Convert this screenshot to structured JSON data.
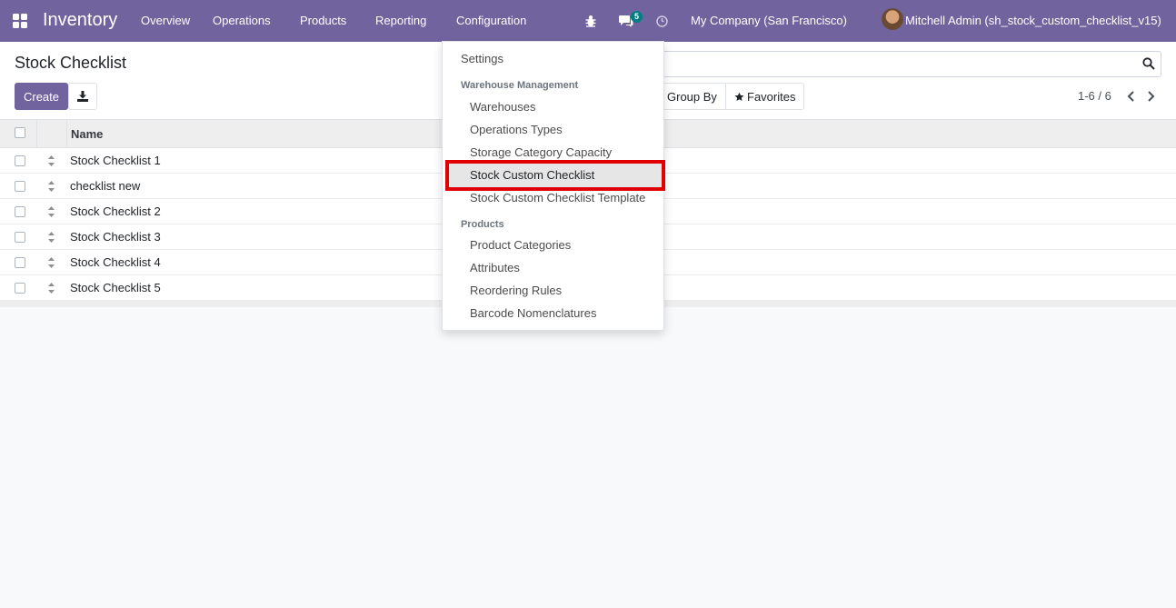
{
  "navbar": {
    "app_name": "Inventory",
    "menu": [
      "Overview",
      "Operations",
      "Products",
      "Reporting",
      "Configuration"
    ],
    "message_count": "5",
    "company": "My Company (San Francisco)",
    "user": "Mitchell Admin (sh_stock_custom_checklist_v15)"
  },
  "control_panel": {
    "title": "Stock Checklist",
    "create_label": "Create",
    "group_by_label": "Group By",
    "favorites_label": "Favorites",
    "pager": "1-6 / 6"
  },
  "list": {
    "column_name": "Name",
    "rows": [
      "Stock Checklist 1",
      "checklist new",
      "Stock Checklist 2",
      "Stock Checklist 3",
      "Stock Checklist 4",
      "Stock Checklist 5"
    ]
  },
  "dropdown": {
    "settings": "Settings",
    "section_warehouse": "Warehouse Management",
    "warehouse_items": [
      "Warehouses",
      "Operations Types",
      "Storage Category Capacity",
      "Stock Custom Checklist",
      "Stock Custom Checklist Template"
    ],
    "section_products": "Products",
    "product_items": [
      "Product Categories",
      "Attributes",
      "Reordering Rules",
      "Barcode Nomenclatures"
    ],
    "active_item": "Stock Custom Checklist"
  },
  "colors": {
    "navbar": "#71639e",
    "highlight_border": "#e00000",
    "badge": "#017e84"
  }
}
